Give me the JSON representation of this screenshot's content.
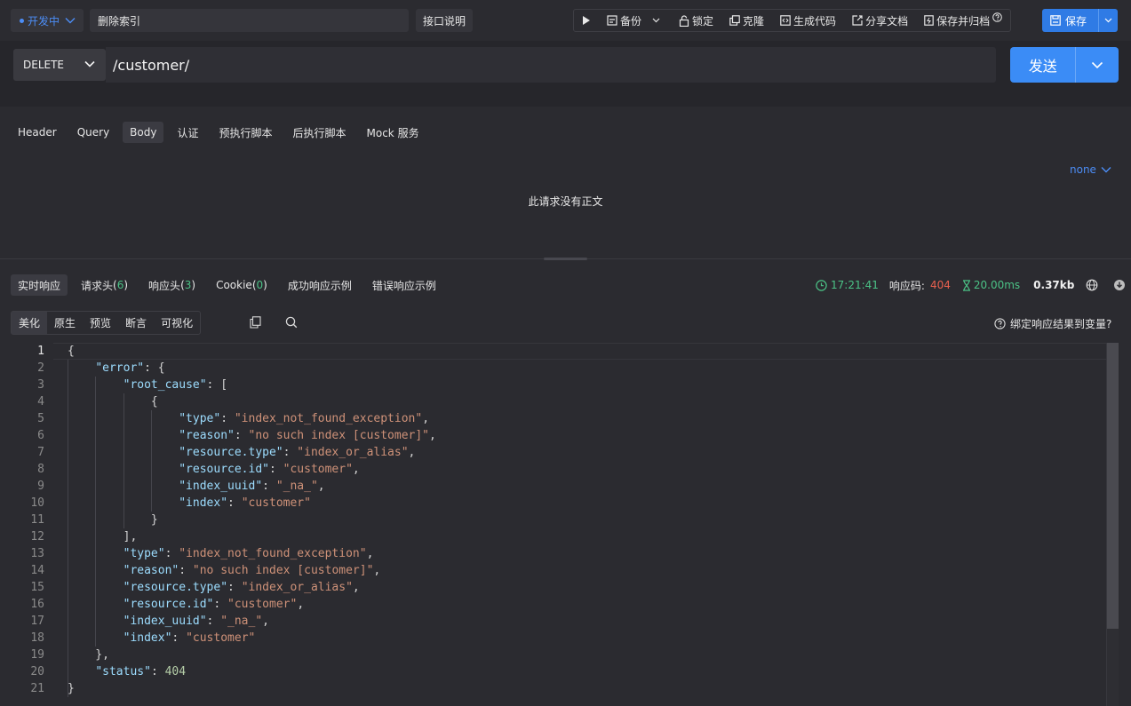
{
  "topbar": {
    "env_label": "开发中",
    "api_name": "删除索引",
    "doc_button": "接口说明",
    "toolbar": {
      "backup": "备份",
      "lock": "锁定",
      "clone": "克隆",
      "gen_code": "生成代码",
      "share_doc": "分享文档",
      "save_archive": "保存并归档"
    },
    "save": "保存"
  },
  "request": {
    "method": "DELETE",
    "url": "/customer/",
    "send": "发送",
    "tabs": [
      "Header",
      "Query",
      "Body",
      "认证",
      "预执行脚本",
      "后执行脚本",
      "Mock 服务"
    ],
    "active_tab": "Body",
    "body_type": "none",
    "no_body_text": "此请求没有正文"
  },
  "response": {
    "tabs": [
      {
        "label": "实时响应",
        "count": ""
      },
      {
        "label": "请求头",
        "count": "6"
      },
      {
        "label": "响应头",
        "count": "3"
      },
      {
        "label": "Cookie",
        "count": "0"
      },
      {
        "label": "成功响应示例",
        "count": ""
      },
      {
        "label": "错误响应示例",
        "count": ""
      }
    ],
    "time": "17:21:41",
    "status_label": "响应码:",
    "status_code": "404",
    "duration": "20.00ms",
    "size": "0.37kb",
    "view_modes": [
      "美化",
      "原生",
      "预览",
      "断言",
      "可视化"
    ],
    "active_view": "美化",
    "bind_var": "绑定响应结果到变量?",
    "code_lines": [
      "{",
      "    \"error\": {",
      "        \"root_cause\": [",
      "            {",
      "                \"type\": \"index_not_found_exception\",",
      "                \"reason\": \"no such index [customer]\",",
      "                \"resource.type\": \"index_or_alias\",",
      "                \"resource.id\": \"customer\",",
      "                \"index_uuid\": \"_na_\",",
      "                \"index\": \"customer\"",
      "            }",
      "        ],",
      "        \"type\": \"index_not_found_exception\",",
      "        \"reason\": \"no such index [customer]\",",
      "        \"resource.type\": \"index_or_alias\",",
      "        \"resource.id\": \"customer\",",
      "        \"index_uuid\": \"_na_\",",
      "        \"index\": \"customer\"",
      "    },",
      "    \"status\": 404",
      "}"
    ]
  },
  "colors": {
    "accent": "#3b8cf6",
    "status_error": "#e8604f",
    "success": "#4bc286",
    "json_key": "#9cdcfe",
    "json_string": "#ce9178",
    "json_number": "#b5cea8"
  }
}
